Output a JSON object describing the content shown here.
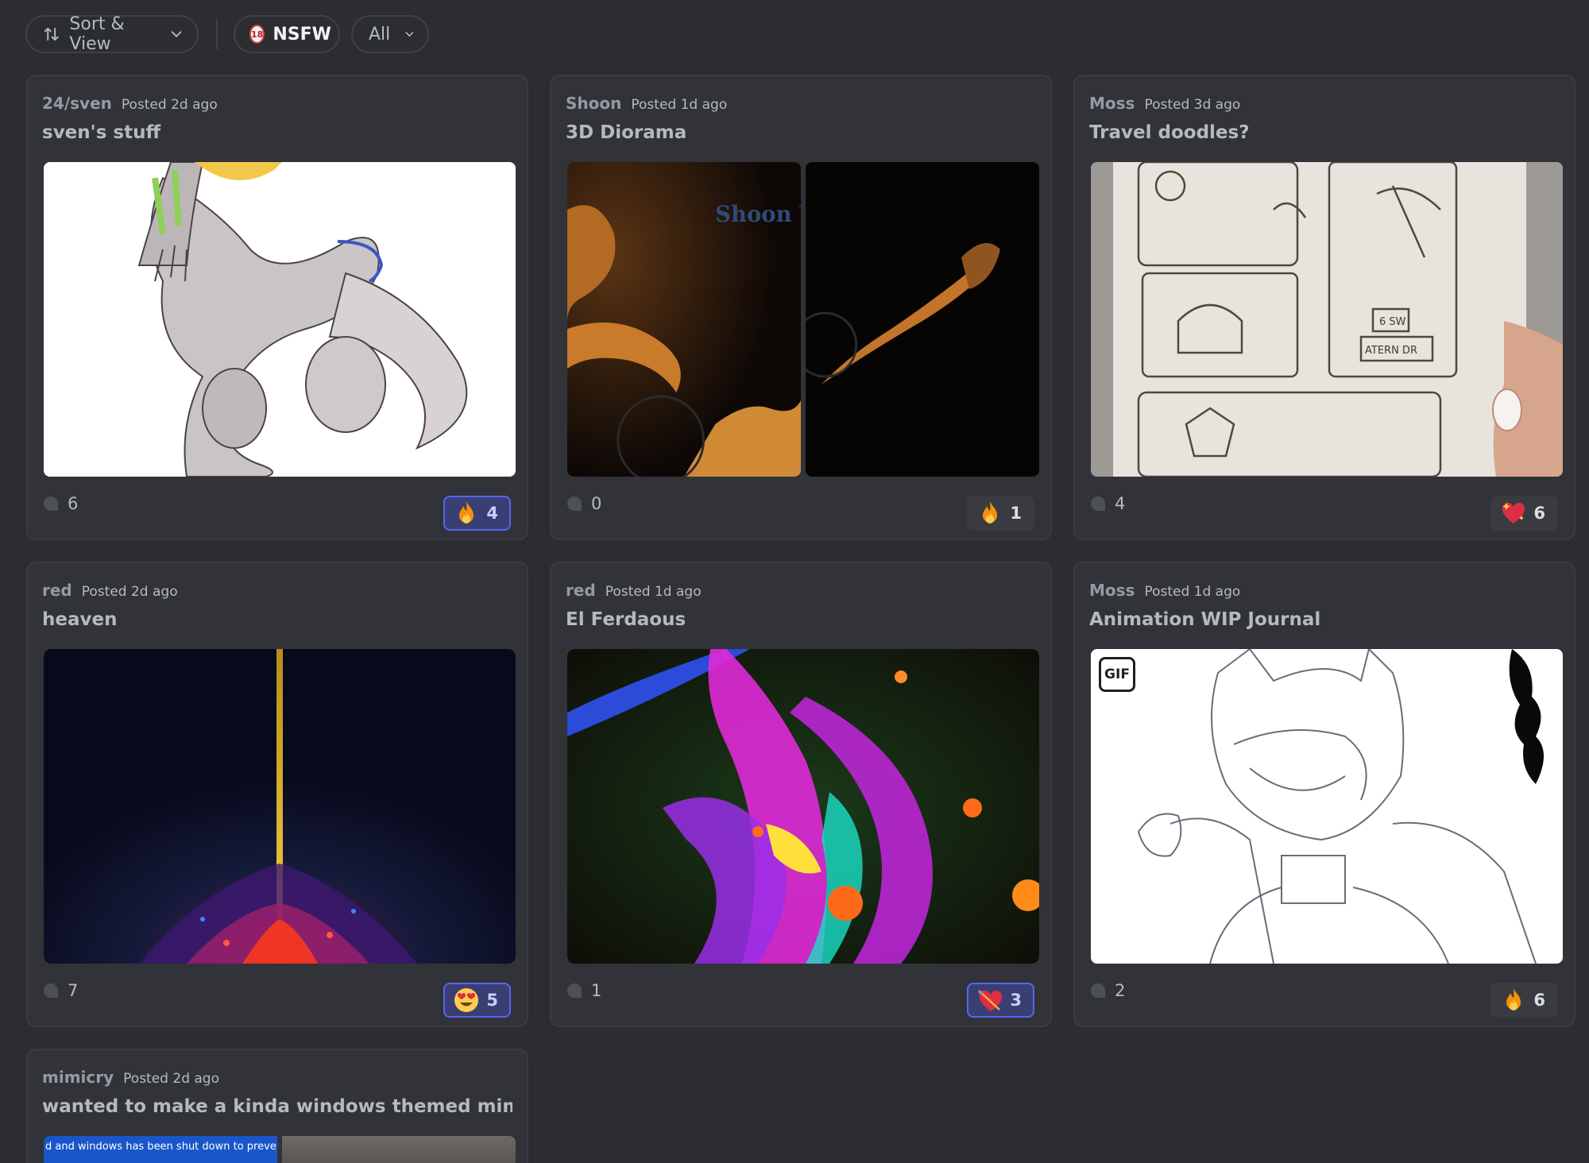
{
  "toolbar": {
    "sort_label": "Sort & View",
    "nsfw_label": "NSFW",
    "age_badge": "18",
    "filter_label": "All",
    "icons": [
      "sort-arrows-icon",
      "chevron-down-icon",
      "age-restricted-icon"
    ]
  },
  "posts": [
    {
      "author": "24/sven",
      "posted": "Posted 2d ago",
      "title": "sven's stuff",
      "comments": "6",
      "reaction": {
        "emoji": "fire",
        "count": "4",
        "mine": true
      }
    },
    {
      "author": "Shoon",
      "posted": "Posted 1d ago",
      "title": "3D Diorama",
      "watermark": "Shoon Vy",
      "comments": "0",
      "reaction": {
        "emoji": "fire",
        "count": "1",
        "mine": false
      }
    },
    {
      "author": "Moss",
      "posted": "Posted 3d ago",
      "title": "Travel doodles?",
      "sketch_text": [
        "6 SW",
        "ATERN DR"
      ],
      "comments": "4",
      "reaction": {
        "emoji": "sparkling-heart",
        "count": "6",
        "mine": false
      }
    },
    {
      "author": "red",
      "posted": "Posted 2d ago",
      "title": "heaven",
      "comments": "7",
      "reaction": {
        "emoji": "heart-eyes",
        "count": "5",
        "mine": true
      }
    },
    {
      "author": "red",
      "posted": "Posted 1d ago",
      "title": "El Ferdaous",
      "comments": "1",
      "reaction": {
        "emoji": "heart-with-arrow",
        "count": "3",
        "mine": true
      }
    },
    {
      "author": "Moss",
      "posted": "Posted 1d ago",
      "title": "Animation WIP Journal",
      "gif_badge": "GIF",
      "comments": "2",
      "reaction": {
        "emoji": "fire",
        "count": "6",
        "mine": false
      }
    },
    {
      "author": "mimicry",
      "posted": "Posted 2d ago",
      "title": "wanted to make a kinda windows themed mimic",
      "preview_text": "d and windows has been shut down to prevent c"
    }
  ],
  "colors": {
    "background": "#2b2d31",
    "card": "#313338",
    "reaction_active_bg": "#3a3f73",
    "reaction_active_border": "#5865f2"
  }
}
